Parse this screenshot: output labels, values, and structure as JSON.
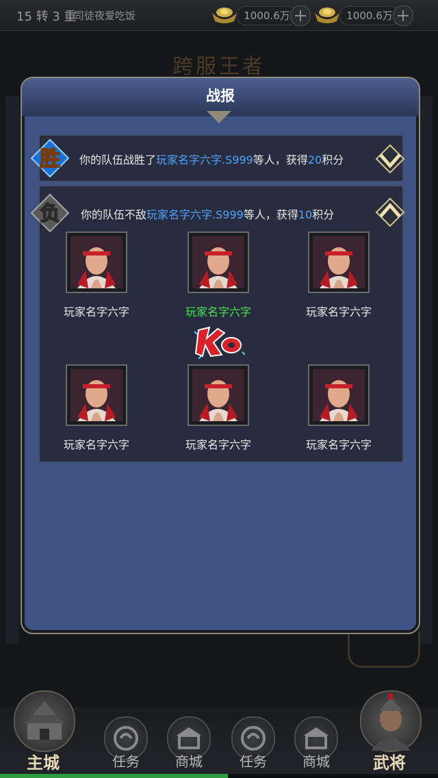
{
  "topbar": {
    "rank": "15 转 3 重",
    "player_name": "司徒夜爱吃饭",
    "currencies": [
      {
        "icon": "gold-ingot-icon",
        "value": "1000.6万"
      },
      {
        "icon": "gold-ingot-icon",
        "value": "1000.6万"
      }
    ]
  },
  "background_title": "跨服王者",
  "dialog": {
    "title": "战报",
    "reports": [
      {
        "result_badge": "胜",
        "prefix": "你的队伍战胜了",
        "opponent": "玩家名字六字.S999",
        "middle": "等人，获得",
        "points": "20",
        "suffix": "积分",
        "expanded": false
      },
      {
        "result_badge": "负",
        "prefix": "你的队伍不敌",
        "opponent": "玩家名字六字.S999",
        "middle": "等人，获得",
        "points": "10",
        "suffix": "积分",
        "expanded": true
      }
    ],
    "detail": {
      "team_top": [
        "玩家名字六字",
        "玩家名字六字",
        "玩家名字六字"
      ],
      "vs_icon": "ko-icon",
      "team_bottom": [
        "玩家名字六字",
        "玩家名字六字",
        "玩家名字六字"
      ],
      "highlight_color": "#49e34f"
    }
  },
  "bottom_nav": {
    "main_city": "主城",
    "items": [
      "任务",
      "商城",
      "任务",
      "商城"
    ],
    "generals": "武将"
  },
  "progress": {
    "fill_fraction": 0.52
  }
}
